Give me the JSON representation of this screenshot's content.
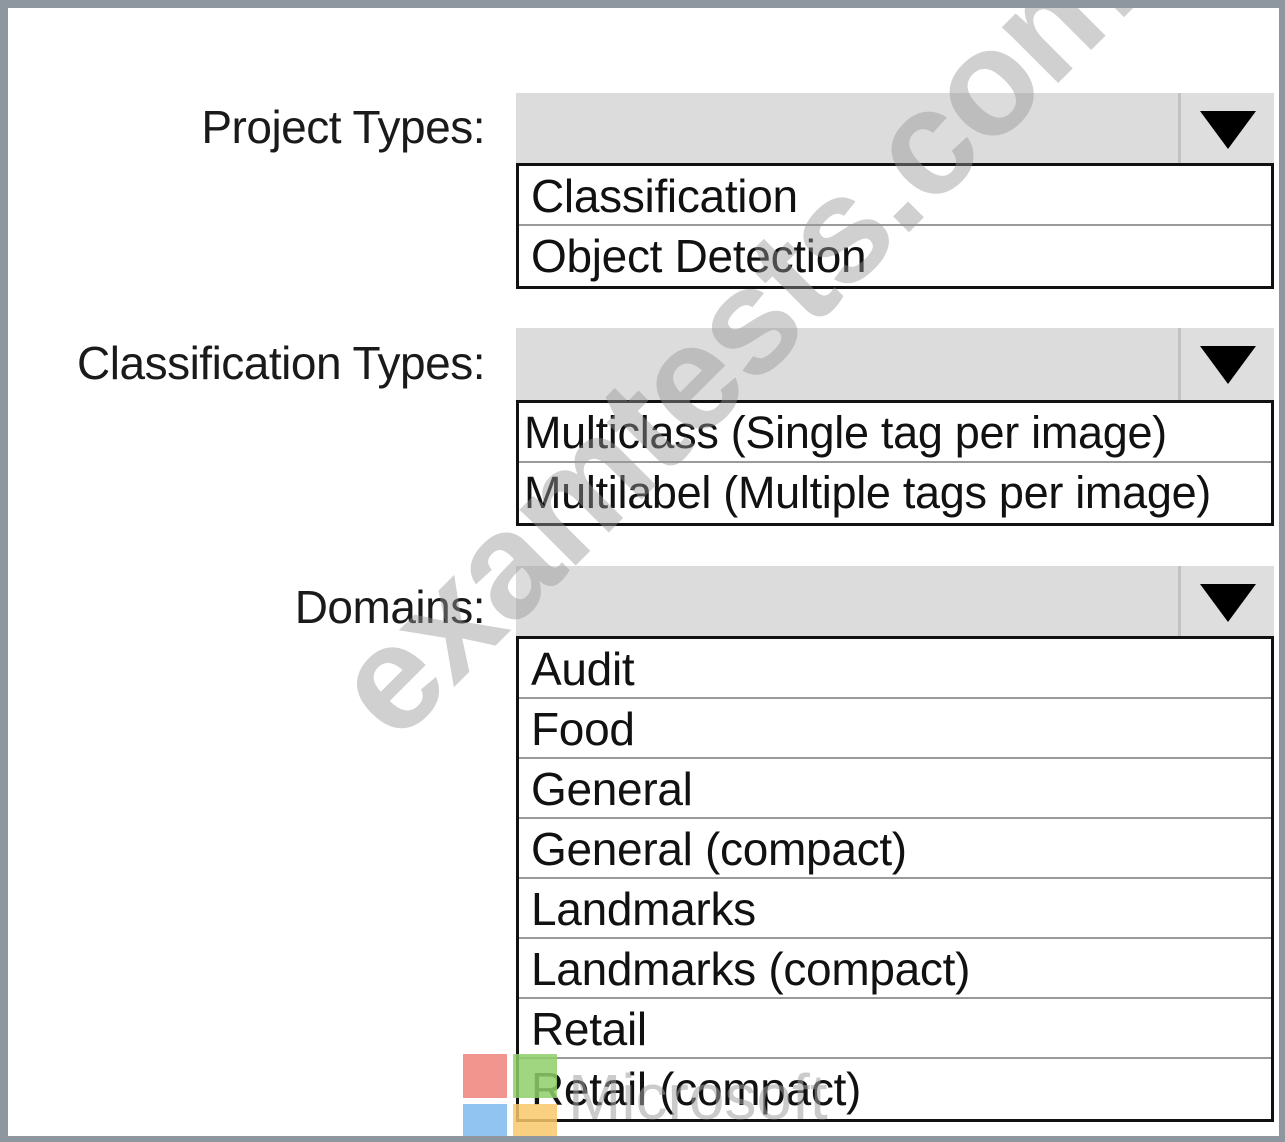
{
  "colors": {
    "frame_border": "#8e96a0",
    "dropdown_background": "#dcdcdc",
    "list_border": "#111111",
    "text": "#1a1a1a",
    "ms_red": "#f0827a",
    "ms_green": "#8fcf6a",
    "ms_blue": "#7fbaf0",
    "ms_yellow": "#f8c86a"
  },
  "project_types": {
    "label": "Project Types:",
    "selected_value": "",
    "icon": "triangle-down-icon",
    "options": [
      "Classification",
      "Object Detection"
    ]
  },
  "classification_types": {
    "label": "Classification Types:",
    "selected_value": "",
    "icon": "triangle-down-icon",
    "options": [
      "Multiclass (Single tag per image)",
      "Multilabel (Multiple tags per image)"
    ]
  },
  "domains": {
    "label": "Domains:",
    "selected_value": "",
    "icon": "triangle-down-icon",
    "options": [
      "Audit",
      "Food",
      "General",
      "General (compact)",
      "Landmarks",
      "Landmarks (compact)",
      "Retail",
      "Retail (compact)"
    ]
  },
  "overlays": {
    "watermark_text": "examtests.com",
    "logo_word": "Microsoft"
  }
}
